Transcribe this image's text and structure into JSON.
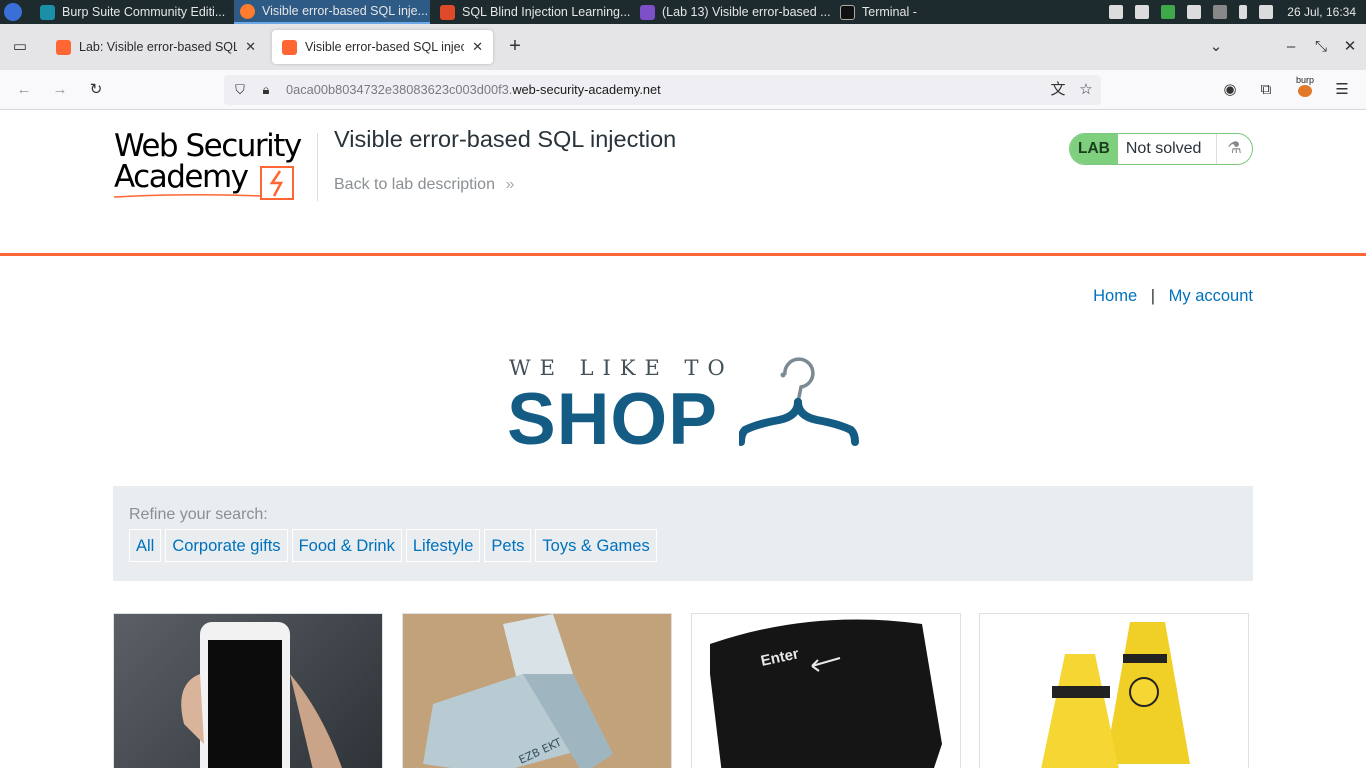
{
  "taskbar": {
    "tasks": [
      {
        "label": "Burp Suite Community Editi..."
      },
      {
        "label": "Visible error-based SQL inje..."
      },
      {
        "label": "SQL Blind Injection Learning..."
      },
      {
        "label": "(Lab 13) Visible error-based ..."
      },
      {
        "label": "Terminal -"
      }
    ],
    "clock": "26 Jul, 16:34"
  },
  "browser": {
    "tabs": [
      {
        "title": "Lab: Visible error-based SQL in",
        "close": "✕"
      },
      {
        "title": "Visible error-based SQL injecti",
        "close": "✕"
      }
    ],
    "new_tab": "+",
    "url_host_prefix": "0aca00b8034732e38083623c003d00f3.",
    "url_domain": "web-security-academy.net",
    "extension_badge": "burp"
  },
  "lab_header": {
    "logo_line1": "Web Security",
    "logo_line2": "Academy",
    "title": "Visible error-based SQL injection",
    "back_link": "Back to lab description",
    "back_chevrons": "»",
    "badge": "LAB",
    "status": "Not solved"
  },
  "nav": {
    "home": "Home",
    "separator": "|",
    "account": "My account"
  },
  "shop_logo": {
    "tagline": "WE LIKE TO",
    "word": "SHOP"
  },
  "filter": {
    "label": "Refine your search:",
    "categories": [
      "All",
      "Corporate gifts",
      "Food & Drink",
      "Lifestyle",
      "Pets",
      "Toys & Games"
    ]
  },
  "products": {
    "card_3_key_text": "Enter"
  },
  "colors": {
    "accent_orange": "#ff6633",
    "link_blue": "#0071bc",
    "shop_blue": "#145c84",
    "lab_green": "#7ed07e"
  }
}
